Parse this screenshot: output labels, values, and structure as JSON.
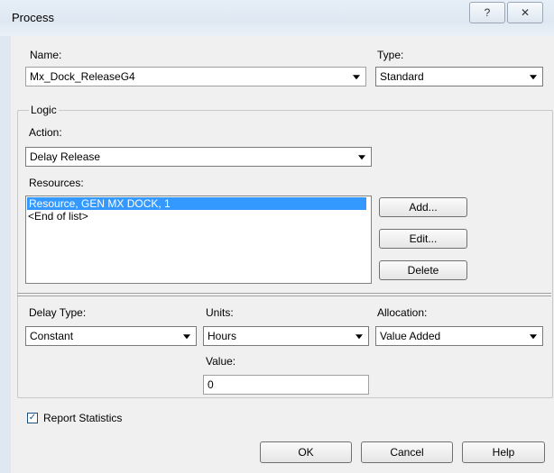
{
  "window": {
    "title": "Process",
    "help_symbol": "?",
    "close_symbol": "✕"
  },
  "name": {
    "label": "Name:",
    "value": "Mx_Dock_ReleaseG4"
  },
  "type": {
    "label": "Type:",
    "value": "Standard"
  },
  "logic": {
    "group_label": "Logic",
    "action_label": "Action:",
    "action_value": "Delay Release",
    "resources_label": "Resources:",
    "resources": [
      "Resource, GEN MX DOCK, 1",
      "<End of list>"
    ],
    "add_label": "Add...",
    "edit_label": "Edit...",
    "delete_label": "Delete",
    "delay_type_label": "Delay Type:",
    "delay_type_value": "Constant",
    "units_label": "Units:",
    "units_value": "Hours",
    "allocation_label": "Allocation:",
    "allocation_value": "Value Added",
    "value_label": "Value:",
    "value_value": "0"
  },
  "report_statistics": {
    "label": "Report Statistics",
    "checked": true,
    "check_glyph": "✓"
  },
  "footer": {
    "ok_label": "OK",
    "cancel_label": "Cancel",
    "help_label": "Help"
  }
}
